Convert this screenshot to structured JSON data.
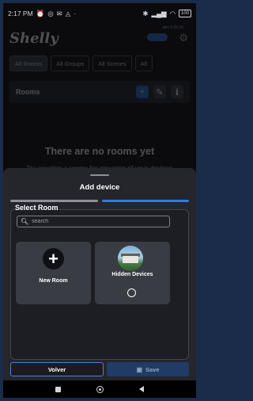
{
  "status_bar": {
    "time": "2:17 PM",
    "left_icons": [
      "alarm-icon",
      "whatsapp-icon",
      "gmail-icon",
      "wifi-assistant-icon"
    ],
    "right_icons": [
      "bluetooth-icon",
      "signal-icon",
      "wifi-icon"
    ],
    "battery": "100"
  },
  "background_app": {
    "logo": "Shelly",
    "version": "dev 3.26.10",
    "tabs": [
      "All Rooms",
      "All Groups",
      "All Scenes",
      "All"
    ],
    "rooms_title": "Rooms",
    "empty_title": "There are no rooms yet",
    "empty_subtitle": "Try creating a rooms for grouping of your devices for your convenience."
  },
  "sheet": {
    "title": "Add device",
    "progress_steps": [
      {
        "state": "inactive",
        "color": "#8d9199"
      },
      {
        "state": "active",
        "color": "#2f7be8"
      }
    ],
    "select_room_label": "Select Room",
    "search_placeholder": "search",
    "cards": [
      {
        "label": "New Room",
        "icon": "plus-icon"
      },
      {
        "label": "Hidden Devices",
        "icon": "house-photo",
        "selected": false
      }
    ],
    "buttons": {
      "back": "Volver",
      "save": "Save"
    }
  },
  "colors": {
    "accent": "#2f7be8",
    "sheet_bg": "#24262c",
    "card_bg": "#393c43"
  }
}
